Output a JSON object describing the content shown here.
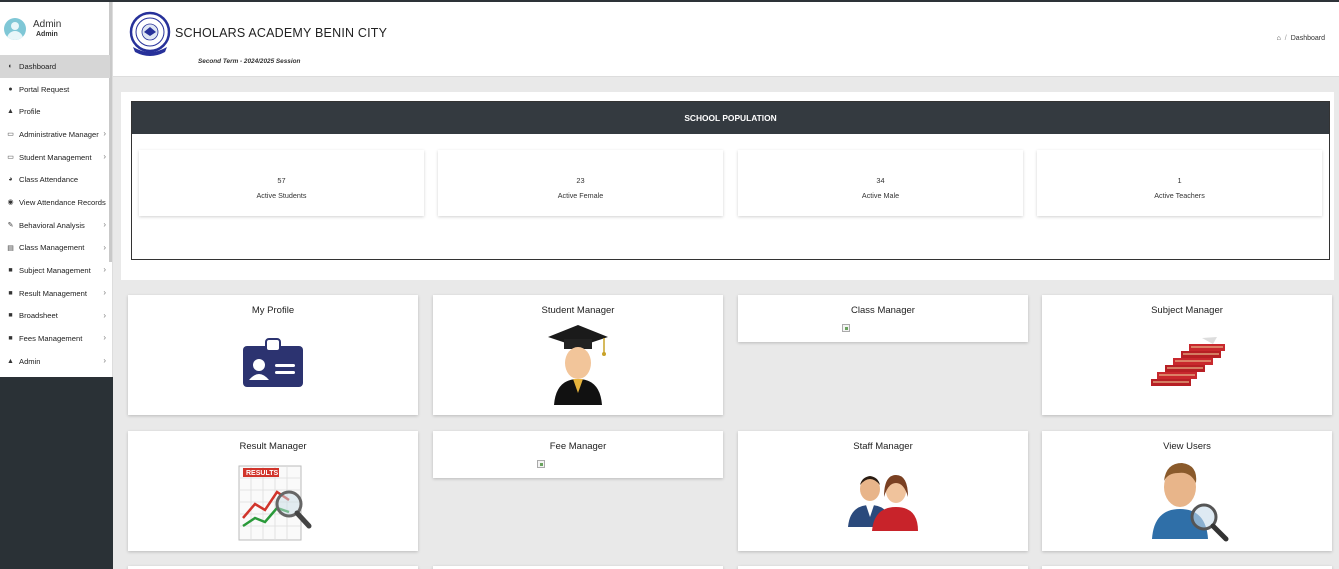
{
  "sidebar": {
    "user": {
      "name": "Admin",
      "role": "Admin"
    },
    "items": [
      {
        "label": "Dashboard",
        "icon": "dashboard-icon",
        "glyph": "◐",
        "chevron": false,
        "active": true
      },
      {
        "label": "Portal Request",
        "icon": "chat-icon",
        "glyph": "●",
        "chevron": false
      },
      {
        "label": "Profile",
        "icon": "user-icon",
        "glyph": "▲",
        "chevron": false
      },
      {
        "label": "Administrative Manager",
        "icon": "laptop-icon",
        "glyph": "▭",
        "chevron": true
      },
      {
        "label": "Student Management",
        "icon": "laptop-icon",
        "glyph": "▭",
        "chevron": true
      },
      {
        "label": "Class Attendance",
        "icon": "pie-chart-icon",
        "glyph": "◕",
        "chevron": false
      },
      {
        "label": "View Attendance Records",
        "icon": "eye-icon",
        "glyph": "◉",
        "chevron": false
      },
      {
        "label": "Behavioral Analysis",
        "icon": "edit-icon",
        "glyph": "✎",
        "chevron": true
      },
      {
        "label": "Class Management",
        "icon": "table-icon",
        "glyph": "▤",
        "chevron": true
      },
      {
        "label": "Subject Management",
        "icon": "file-icon",
        "glyph": "■",
        "chevron": true
      },
      {
        "label": "Result Management",
        "icon": "book-icon",
        "glyph": "■",
        "chevron": true
      },
      {
        "label": "Broadsheet",
        "icon": "book-icon",
        "glyph": "■",
        "chevron": true
      },
      {
        "label": "Fees Management",
        "icon": "book-icon",
        "glyph": "■",
        "chevron": true
      },
      {
        "label": "Admin",
        "icon": "user-icon",
        "glyph": "▲",
        "chevron": true
      }
    ]
  },
  "header": {
    "school_name": "SCHOLARS ACADEMY BENIN CITY",
    "term": "Second Term - 2024/2025 Session",
    "breadcrumb": {
      "home_glyph": "⌂",
      "separator": "/",
      "current": "Dashboard"
    }
  },
  "population": {
    "title": "SCHOOL POPULATION",
    "stats": [
      {
        "value": "57",
        "label": "Active Students"
      },
      {
        "value": "23",
        "label": "Active Female"
      },
      {
        "value": "34",
        "label": "Active Male"
      },
      {
        "value": "1",
        "label": "Active Teachers"
      }
    ]
  },
  "cards": [
    {
      "title": "My Profile",
      "icon": "id-card-icon"
    },
    {
      "title": "Student Manager",
      "icon": "graduate-icon"
    },
    {
      "title": "Class Manager",
      "icon": "broken-image-icon"
    },
    {
      "title": "Subject Manager",
      "icon": "books-icon"
    },
    {
      "title": "Result Manager",
      "icon": "results-chart-icon"
    },
    {
      "title": "Fee Manager",
      "icon": "broken-image-icon"
    },
    {
      "title": "Staff Manager",
      "icon": "staff-icon"
    },
    {
      "title": "View Users",
      "icon": "user-search-icon"
    }
  ],
  "colors": {
    "sidebar_dark": "#2a3136",
    "panel_header": "#343a40",
    "id_card": "#2c3370",
    "background": "#e9e9e9"
  }
}
